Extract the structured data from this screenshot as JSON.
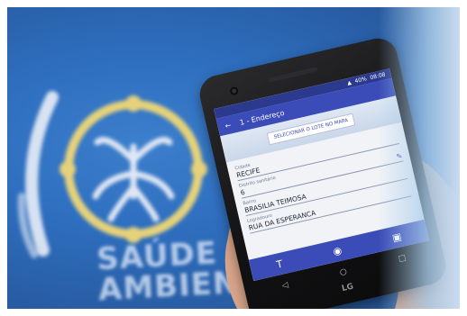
{
  "background": {
    "wall_text": [
      "SAÚDE",
      "AMBIENTAL"
    ],
    "colors": {
      "wall_blue": "#2f6fc0",
      "logo_yellow": "#e6d27a",
      "logo_white": "#e9eef7"
    }
  },
  "phone": {
    "brand": "LG",
    "status": {
      "battery": "40%",
      "time": "08:08"
    },
    "app_bar": {
      "back_icon": "arrow-left-icon",
      "title": "1 - Endereço"
    },
    "map_button": "SELECIONAR O LOTE NO MAPA",
    "fields": [
      {
        "label": "Cidade",
        "value": "RECIFE"
      },
      {
        "label": "Distrito sanitário",
        "value": "6"
      },
      {
        "label": "Bairro",
        "value": "BRASILIA TEIMOSA"
      },
      {
        "label": "Logradouro",
        "value": "RUA DA ESPERANCA"
      }
    ],
    "actions": [
      "text-icon",
      "camera-icon",
      "gallery-icon"
    ],
    "nav": [
      "back-icon",
      "home-icon",
      "recents-icon"
    ],
    "colors": {
      "primary": "#3b4cb8",
      "statusbar": "#2b3a8f"
    }
  }
}
